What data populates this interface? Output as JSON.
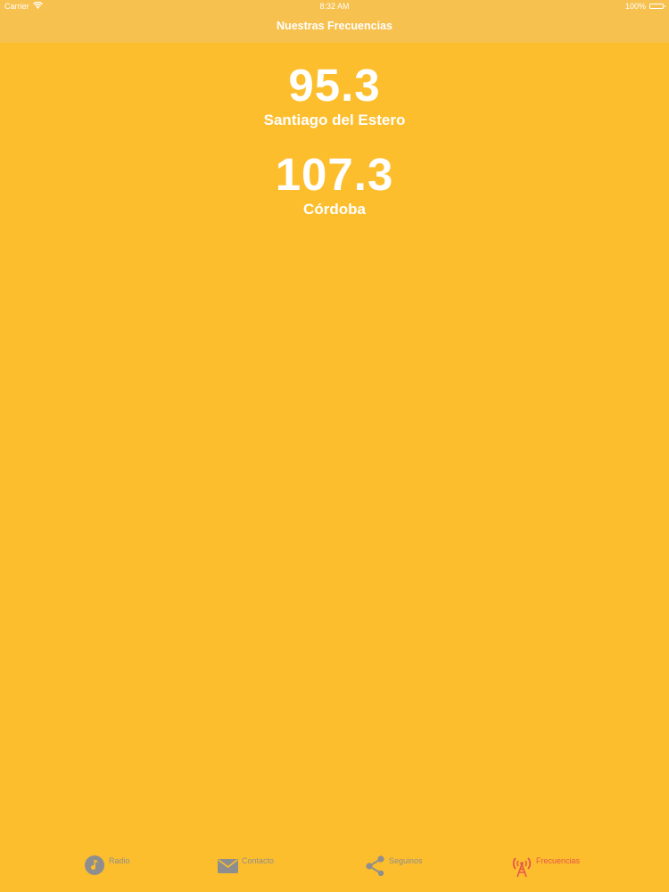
{
  "status_bar": {
    "carrier": "Carrier",
    "time": "8:32 AM",
    "battery": "100%"
  },
  "nav": {
    "title": "Nuestras Frecuencias"
  },
  "frequencies": [
    {
      "value": "95.3",
      "city": "Santiago del Estero"
    },
    {
      "value": "107.3",
      "city": "Córdoba"
    }
  ],
  "tabs": [
    {
      "label": "Radio",
      "icon": "music-disc-icon",
      "active": false
    },
    {
      "label": "Contacto",
      "icon": "envelope-icon",
      "active": false
    },
    {
      "label": "Seguinos",
      "icon": "share-icon",
      "active": false
    },
    {
      "label": "Frecuencias",
      "icon": "antenna-icon",
      "active": true
    }
  ],
  "colors": {
    "background": "#FDBE2D",
    "nav_bar": "#F7C150",
    "tab_inactive": "#8E8E8E",
    "tab_active": "#E5564B"
  }
}
